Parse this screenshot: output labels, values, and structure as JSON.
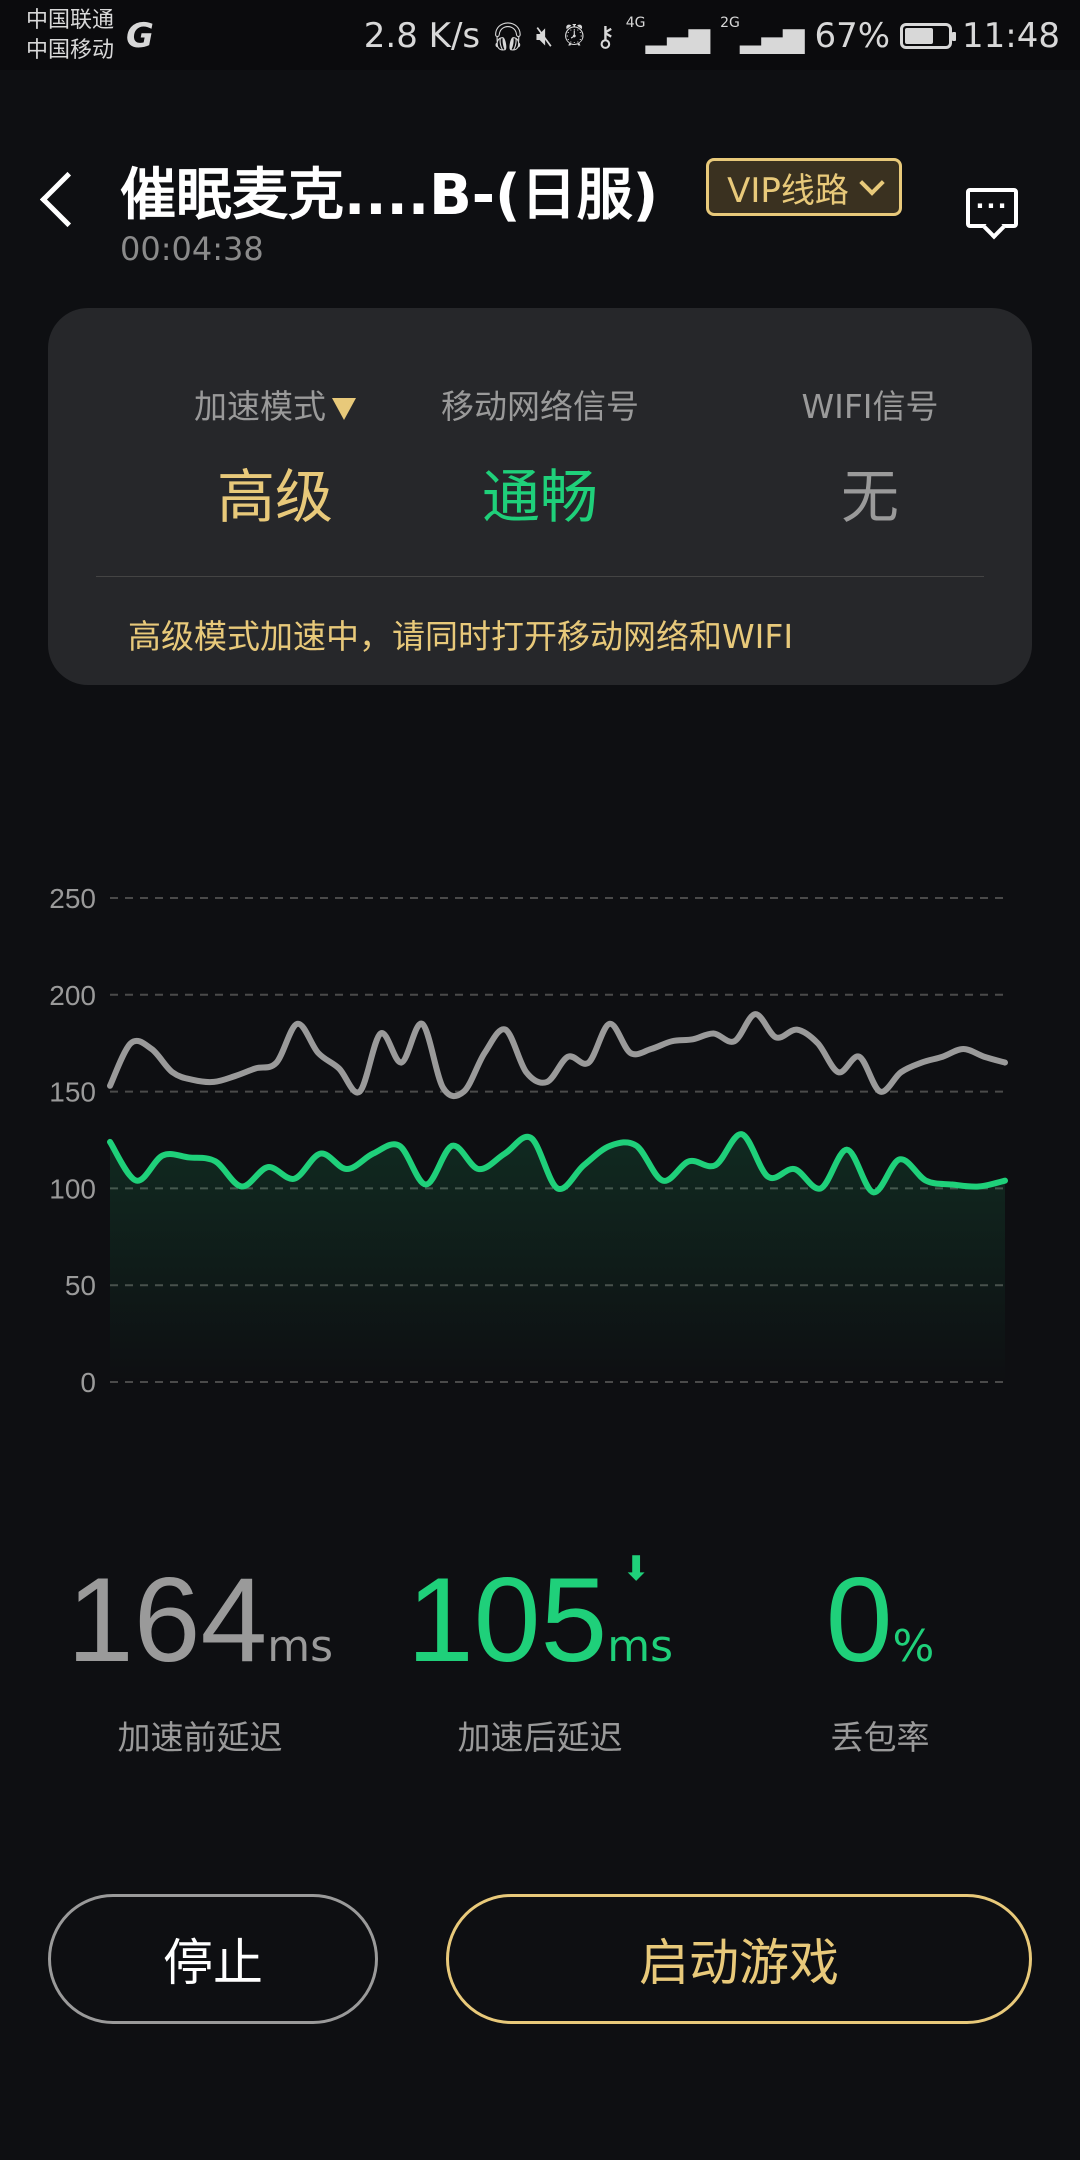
{
  "status_bar": {
    "carrier1": "中国联通",
    "carrier2": "中国移动",
    "speed": "2.8 K/s",
    "net1": "4G",
    "net2": "2G",
    "battery": "67%",
    "battery_level": 0.67,
    "time": "11:48"
  },
  "header": {
    "title": "催眠麦克....B-(日服)",
    "timer": "00:04:38",
    "vip_label": "VIP线路"
  },
  "info_card": {
    "mode_label": "加速模式",
    "mode_value": "高级",
    "mobile_label": "移动网络信号",
    "mobile_value": "通畅",
    "wifi_label": "WIFI信号",
    "wifi_value": "无",
    "notice": "高级模式加速中，请同时打开移动网络和WIFI"
  },
  "colors": {
    "accent_gold": "#e8c97a",
    "accent_green": "#1fd07a",
    "grey": "#9a9a9a",
    "card_bg": "#26272a",
    "bg": "#0e0f12"
  },
  "chart_data": {
    "type": "line",
    "ylim": [
      0,
      250
    ],
    "yticks": [
      "0",
      "50",
      "100",
      "150",
      "200",
      "250"
    ],
    "grid": true,
    "series": [
      {
        "values": [
          153,
          175,
          172,
          160,
          156,
          155,
          158,
          162,
          165,
          185,
          170,
          162,
          150,
          180,
          165,
          185,
          152,
          150,
          170,
          182,
          160,
          155,
          168,
          165,
          185,
          170,
          172,
          176,
          177,
          180,
          176,
          190,
          178,
          182,
          175,
          160,
          168,
          150,
          160,
          165,
          168,
          172,
          168,
          165
        ]
      },
      {
        "values": [
          124,
          104,
          117,
          116,
          114,
          101,
          111,
          105,
          118,
          110,
          118,
          122,
          102,
          122,
          110,
          118,
          126,
          100,
          112,
          122,
          122,
          104,
          114,
          112,
          128,
          106,
          110,
          100,
          120,
          98,
          115,
          104,
          102,
          101,
          104
        ]
      }
    ]
  },
  "stats": {
    "before_value": "164",
    "before_unit": "ms",
    "before_label": "加速前延迟",
    "after_value": "105",
    "after_unit": "ms",
    "after_label": "加速后延迟",
    "loss_value": "0",
    "loss_unit": "%",
    "loss_label": "丢包率"
  },
  "buttons": {
    "stop": "停止",
    "start": "启动游戏"
  }
}
